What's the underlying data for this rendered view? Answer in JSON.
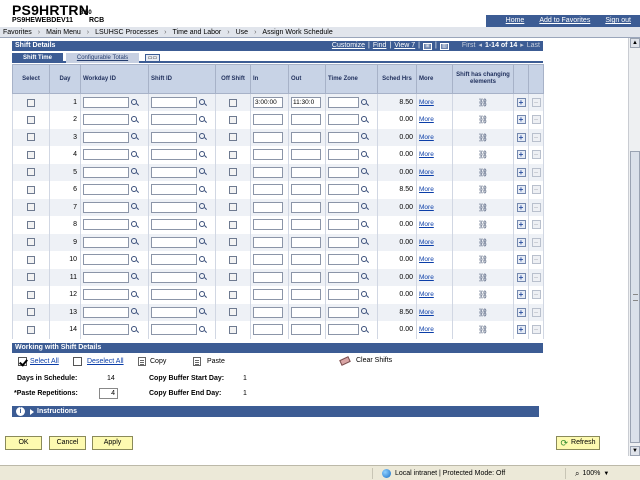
{
  "header": {
    "app_title": "PS9HRTRN",
    "version": "8.50",
    "database": "PS9HEWEBDEV11",
    "user": "RCB",
    "top_links": [
      "Home",
      "Add to Favorites",
      "Sign out"
    ]
  },
  "breadcrumb": [
    "Favorites",
    "Main Menu",
    "LSUHSC Processes",
    "Time and Labor",
    "Use",
    "Assign Work Schedule"
  ],
  "grid": {
    "title": "Shift Details",
    "nav": {
      "customize": "Customize",
      "find": "Find",
      "view": "View 7",
      "first": "First",
      "range": "1-14 of 14",
      "last": "Last"
    },
    "tabs": [
      "Shift Time",
      "Configurable Totals"
    ],
    "columns": [
      "Select",
      "Day",
      "Workday ID",
      "Shift ID",
      "Off Shift",
      "In",
      "Out",
      "Time Zone",
      "Sched Hrs",
      "More",
      "Shift has changing elements"
    ],
    "rows": [
      {
        "day": "1",
        "in": "3:00:00",
        "out": "11:30:0",
        "hrs": "8.50",
        "more": "More"
      },
      {
        "day": "2",
        "in": "",
        "out": "",
        "hrs": "0.00",
        "more": "More"
      },
      {
        "day": "3",
        "in": "",
        "out": "",
        "hrs": "0.00",
        "more": "More"
      },
      {
        "day": "4",
        "in": "",
        "out": "",
        "hrs": "0.00",
        "more": "More"
      },
      {
        "day": "5",
        "in": "",
        "out": "",
        "hrs": "0.00",
        "more": "More"
      },
      {
        "day": "6",
        "in": "",
        "out": "",
        "hrs": "8.50",
        "more": "More"
      },
      {
        "day": "7",
        "in": "",
        "out": "",
        "hrs": "0.00",
        "more": "More"
      },
      {
        "day": "8",
        "in": "",
        "out": "",
        "hrs": "0.00",
        "more": "More"
      },
      {
        "day": "9",
        "in": "",
        "out": "",
        "hrs": "0.00",
        "more": "More"
      },
      {
        "day": "10",
        "in": "",
        "out": "",
        "hrs": "0.00",
        "more": "More"
      },
      {
        "day": "11",
        "in": "",
        "out": "",
        "hrs": "0.00",
        "more": "More"
      },
      {
        "day": "12",
        "in": "",
        "out": "",
        "hrs": "0.00",
        "more": "More"
      },
      {
        "day": "13",
        "in": "",
        "out": "",
        "hrs": "8.50",
        "more": "More"
      },
      {
        "day": "14",
        "in": "",
        "out": "",
        "hrs": "0.00",
        "more": "More"
      }
    ]
  },
  "working": {
    "title": "Working with Shift Details",
    "select_all": "Select All",
    "deselect_all": "Deselect All",
    "copy": "Copy",
    "paste": "Paste",
    "clear_shifts": "Clear Shifts",
    "days_label": "Days in Schedule:",
    "days_value": "14",
    "paste_rep_label": "*Paste Repetitions:",
    "paste_rep_value": "4",
    "buffer_start_label": "Copy Buffer Start Day:",
    "buffer_start_value": "1",
    "buffer_end_label": "Copy Buffer End Day:",
    "buffer_end_value": "1"
  },
  "instructions": "Instructions",
  "buttons": {
    "ok": "OK",
    "cancel": "Cancel",
    "apply": "Apply",
    "refresh": "Refresh"
  },
  "statusbar": {
    "zone": "Local intranet | Protected Mode: Off",
    "zoom": "100%"
  },
  "colors": {
    "header_blue": "#3c5c94",
    "button_yellow": "#fdfab0",
    "link_blue": "#0b3ea8"
  }
}
